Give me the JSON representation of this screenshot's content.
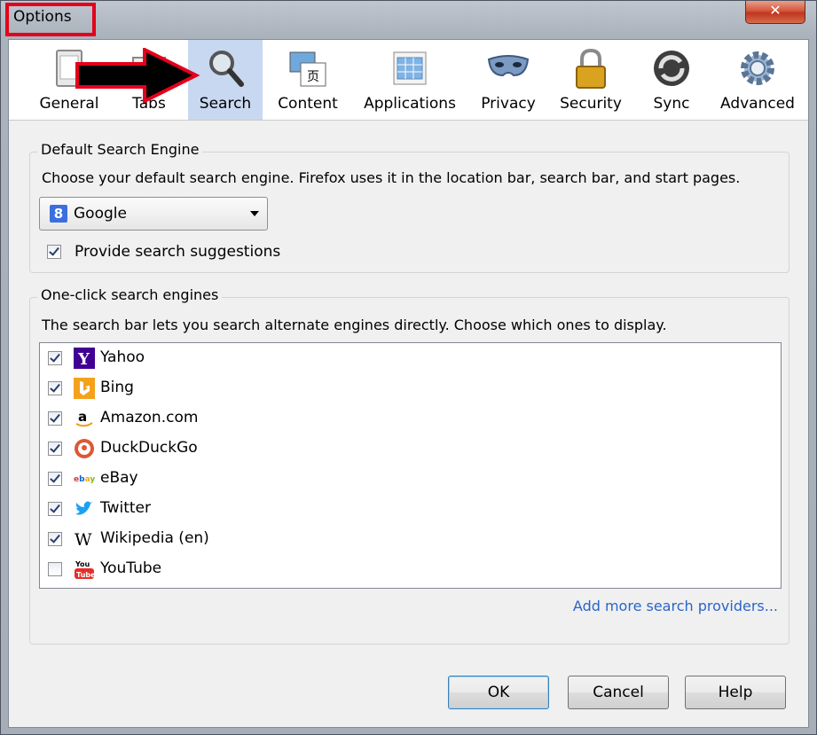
{
  "window": {
    "title": "Options",
    "close_glyph": "✕"
  },
  "tabs": [
    {
      "label": "General",
      "icon": "general-icon"
    },
    {
      "label": "Tabs",
      "icon": "tabs-icon"
    },
    {
      "label": "Search",
      "icon": "search-icon",
      "active": true
    },
    {
      "label": "Content",
      "icon": "content-icon"
    },
    {
      "label": "Applications",
      "icon": "applications-icon"
    },
    {
      "label": "Privacy",
      "icon": "privacy-mask-icon"
    },
    {
      "label": "Security",
      "icon": "padlock-icon"
    },
    {
      "label": "Sync",
      "icon": "sync-icon"
    },
    {
      "label": "Advanced",
      "icon": "gear-icon"
    }
  ],
  "default_engine": {
    "legend": "Default Search Engine",
    "description": "Choose your default search engine. Firefox uses it in the location bar, search bar, and start pages.",
    "selected": "Google",
    "suggestions_label": "Provide search suggestions",
    "suggestions_checked": true
  },
  "one_click": {
    "legend": "One-click search engines",
    "description": "The search bar lets you search alternate engines directly. Choose which ones to display.",
    "engines": [
      {
        "name": "Yahoo",
        "checked": true,
        "icon": "yahoo-icon"
      },
      {
        "name": "Bing",
        "checked": true,
        "icon": "bing-icon"
      },
      {
        "name": "Amazon.com",
        "checked": true,
        "icon": "amazon-icon"
      },
      {
        "name": "DuckDuckGo",
        "checked": true,
        "icon": "duckduckgo-icon"
      },
      {
        "name": "eBay",
        "checked": true,
        "icon": "ebay-icon"
      },
      {
        "name": "Twitter",
        "checked": true,
        "icon": "twitter-icon"
      },
      {
        "name": "Wikipedia (en)",
        "checked": true,
        "icon": "wikipedia-icon"
      },
      {
        "name": "YouTube",
        "checked": false,
        "icon": "youtube-icon"
      }
    ],
    "add_more_link": "Add more search providers..."
  },
  "buttons": {
    "ok": "OK",
    "cancel": "Cancel",
    "help": "Help"
  },
  "colors": {
    "annotation_red": "#e3001b",
    "active_tab": "#c8d8f0",
    "link": "#2a65c9"
  }
}
